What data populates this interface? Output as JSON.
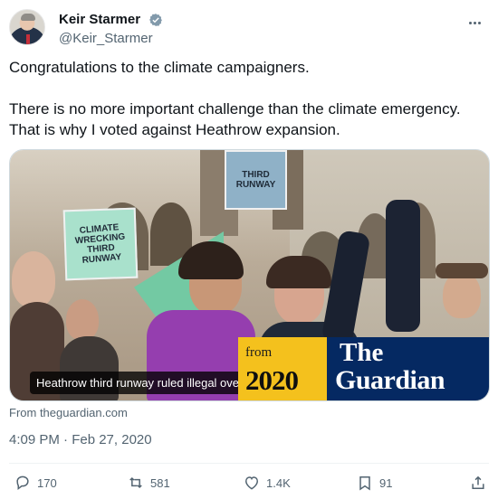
{
  "author": {
    "display_name": "Keir Starmer",
    "handle": "@Keir_Starmer",
    "verified_icon": "verified-badge-icon",
    "accent": "#1d9bf0"
  },
  "tweet": {
    "paragraphs": [
      "Congratulations to the climate campaigners.",
      "There is no more important challenge than the climate emergency. That is why I voted against Heathrow expansion."
    ]
  },
  "card": {
    "overlay_caption": "Heathrow third runway ruled illegal over climate change",
    "banner_from": "from",
    "banner_year": "2020",
    "banner_the": "The",
    "banner_name": "Guardian",
    "placards": [
      "THIRD RUNWAY",
      "CLIMATE WRECKING THIRD RUNWAY"
    ],
    "colors": {
      "guardian_blue": "#052962",
      "banner_yellow": "#f4c11d",
      "sign_green": "#78cda9"
    }
  },
  "source_text": "From theguardian.com",
  "timestamp": "4:09 PM · Feb 27, 2020",
  "actions": {
    "reply_count": "170",
    "retweet_count": "581",
    "like_count": "1.4K",
    "bookmark_count": "91"
  }
}
